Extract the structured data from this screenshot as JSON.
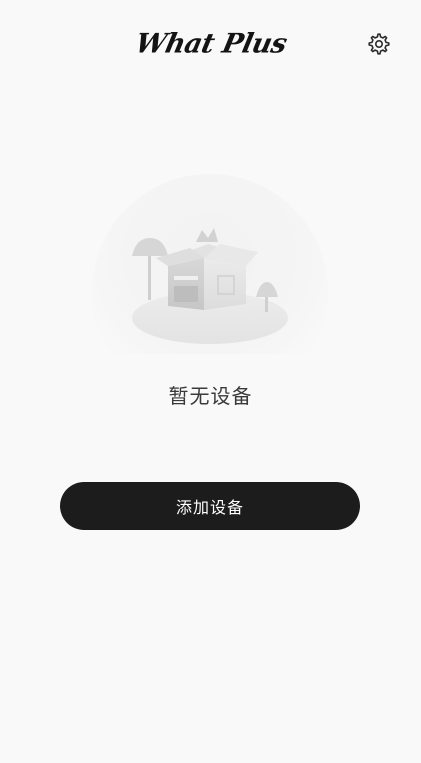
{
  "header": {
    "logo_text": "What Plus",
    "settings_icon": "gear-icon"
  },
  "empty_state": {
    "illustration": "empty-box-illustration",
    "message": "暂无设备"
  },
  "actions": {
    "add_device_label": "添加设备"
  },
  "colors": {
    "background": "#f9f9f9",
    "button_bg": "#1c1c1c",
    "button_text": "#ffffff",
    "message_text": "#3a3a3a"
  }
}
